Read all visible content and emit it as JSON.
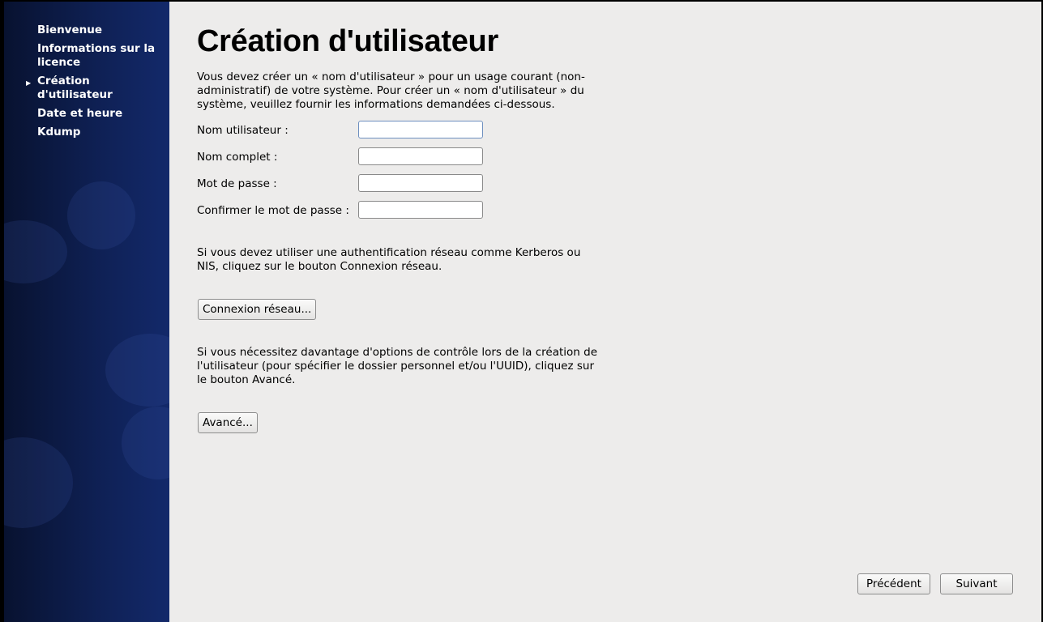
{
  "sidebar": {
    "items": [
      {
        "label": "Bienvenue"
      },
      {
        "label": "Informations sur la licence"
      },
      {
        "label": "Création d'utilisateur",
        "active": true
      },
      {
        "label": "Date et heure"
      },
      {
        "label": "Kdump"
      }
    ],
    "active_icon": "triangle-right-icon"
  },
  "main": {
    "title": "Création d'utilisateur",
    "intro": "Vous devez créer un « nom d'utilisateur » pour un usage courant (non-administratif) de votre système. Pour créer un « nom d'utilisateur » du système, veuillez fournir les informations demandées ci-dessous.",
    "fields": [
      {
        "label": "Nom utilisateur :",
        "value": ""
      },
      {
        "label": "Nom complet :",
        "value": ""
      },
      {
        "label": "Mot de passe :",
        "value": ""
      },
      {
        "label": "Confirmer le mot de passe :",
        "value": ""
      }
    ],
    "network_text": "Si vous devez utiliser une authentification réseau comme Kerberos ou NIS, cliquez sur le bouton Connexion réseau.",
    "network_button": "Connexion réseau...",
    "advanced_text": "Si vous nécessitez davantage d'options de contrôle lors de la création de l'utilisateur (pour spécifier le dossier personnel et/ou l'UUID), cliquez sur le bouton Avancé.",
    "advanced_button": "Avancé...",
    "back_button": "Précédent",
    "next_button": "Suivant"
  }
}
